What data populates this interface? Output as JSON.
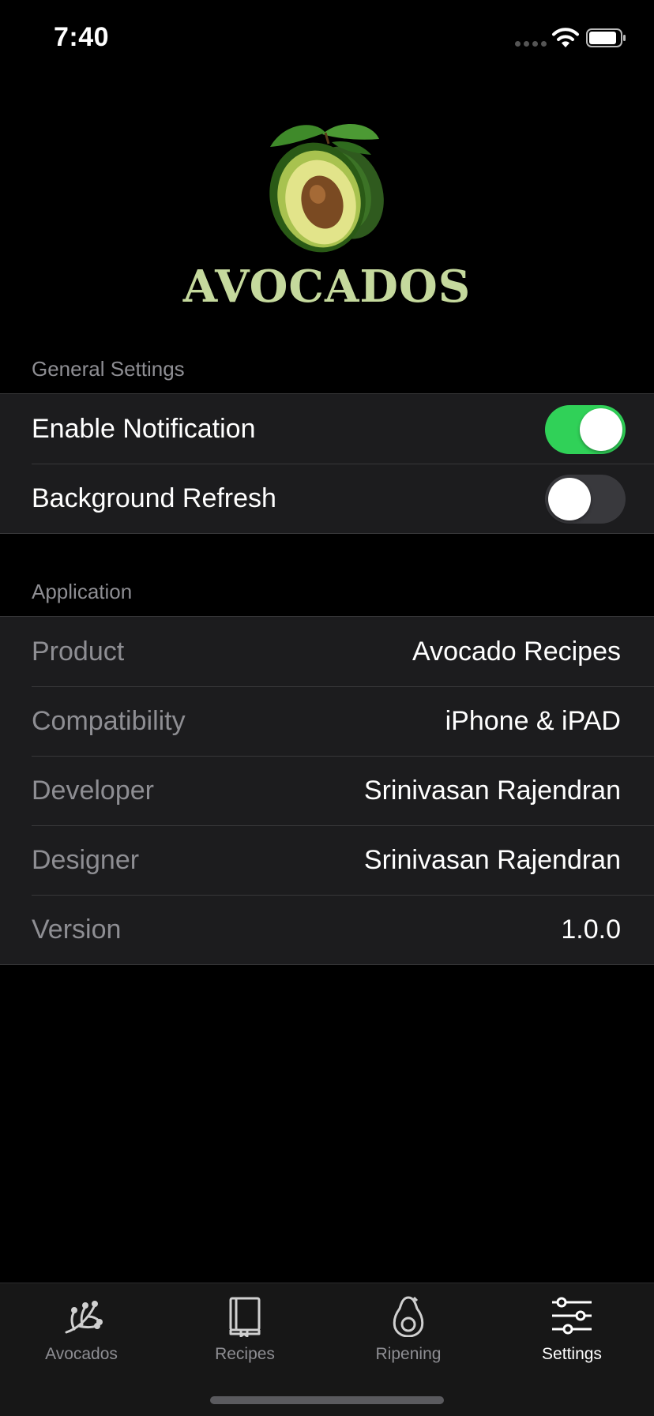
{
  "status": {
    "time": "7:40"
  },
  "header": {
    "title": "AVOCADOS",
    "logo_icon": "avocado-icon"
  },
  "general": {
    "header": "General Settings",
    "rows": [
      {
        "label": "Enable Notification",
        "enabled": true
      },
      {
        "label": "Background Refresh",
        "enabled": false
      }
    ]
  },
  "application": {
    "header": "Application",
    "rows": [
      {
        "label": "Product",
        "value": "Avocado Recipes"
      },
      {
        "label": "Compatibility",
        "value": "iPhone & iPAD"
      },
      {
        "label": "Developer",
        "value": "Srinivasan Rajendran"
      },
      {
        "label": "Designer",
        "value": "Srinivasan Rajendran"
      },
      {
        "label": "Version",
        "value": "1.0.0"
      }
    ]
  },
  "tabs": [
    {
      "label": "Avocados",
      "icon": "branch-icon",
      "active": false
    },
    {
      "label": "Recipes",
      "icon": "book-icon",
      "active": false
    },
    {
      "label": "Ripening",
      "icon": "avocado-outline-icon",
      "active": false
    },
    {
      "label": "Settings",
      "icon": "sliders-icon",
      "active": true
    }
  ],
  "colors": {
    "accent_toggle": "#30d158",
    "title": "#c5d99d",
    "background": "#000000",
    "group_background": "#1c1c1e"
  }
}
